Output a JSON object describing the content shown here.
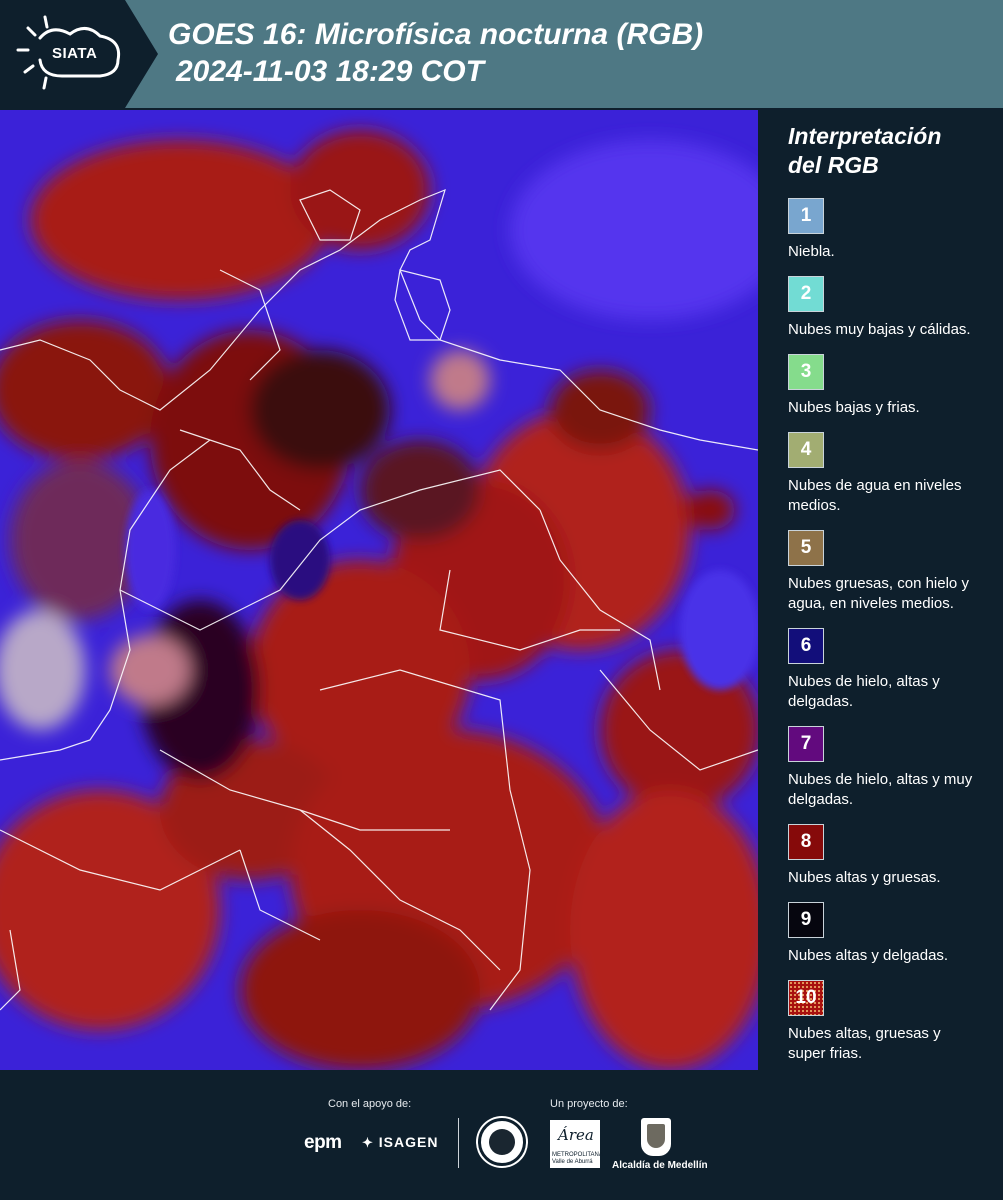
{
  "header": {
    "logo": "SIATA",
    "title_line1": "GOES 16: Microfísica nocturna (RGB)",
    "title_line2": "2024-11-03 18:29 COT"
  },
  "legend": {
    "title_line1": "Interpretación",
    "title_line2": "del RGB",
    "items": [
      {
        "number": "1",
        "label": "Niebla.",
        "color": "#79a6cf"
      },
      {
        "number": "2",
        "label": "Nubes muy bajas y cálidas.",
        "color": "#72dcd4"
      },
      {
        "number": "3",
        "label": "Nubes bajas y frias.",
        "color": "#85dc8c"
      },
      {
        "number": "4",
        "label": "Nubes de agua en niveles medios.",
        "color": "#a2ad72"
      },
      {
        "number": "5",
        "label": "Nubes gruesas, con hielo y agua, en niveles medios.",
        "color": "#8e7249"
      },
      {
        "number": "6",
        "label": "Nubes de hielo, altas y delgadas.",
        "color": "#120e7a"
      },
      {
        "number": "7",
        "label": "Nubes de hielo, altas y muy delgadas.",
        "color": "#620a7e"
      },
      {
        "number": "8",
        "label": "Nubes altas y gruesas.",
        "color": "#860a0a"
      },
      {
        "number": "9",
        "label": "Nubes altas y delgadas.",
        "color": "#06060f"
      },
      {
        "number": "10",
        "label": "Nubes altas, gruesas y super frias.",
        "color": "#a8100e"
      }
    ]
  },
  "footer": {
    "support_label": "Con el apoyo de:",
    "project_label": "Un proyecto de:",
    "sponsor1": "epm",
    "sponsor2": "ISAGEN",
    "area_word": "Área",
    "area_sub": "METROPOLITANA Valle de Aburrá",
    "alcaldia": "Alcaldía de Medellín"
  }
}
